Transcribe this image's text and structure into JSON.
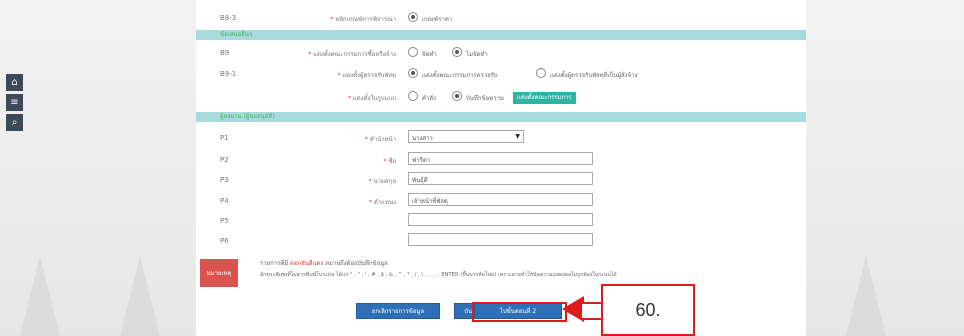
{
  "sidebar": {
    "icons": [
      "home-icon",
      "menu-icon",
      "search-icon"
    ],
    "glyphs": [
      "⌂",
      "≡",
      "⌕"
    ]
  },
  "form": {
    "row_b8_3": {
      "code": "B8-3",
      "label": "หลักเกณฑ์การพิจารณา",
      "option": "เกณฑ์ราคา"
    },
    "section_other": "ข้อเสนออื่นๆ",
    "row_b9": {
      "code": "B9",
      "label": "แต่งตั้งคณะกรรมการซื้อหรือจ้าง",
      "opt1": "จัดทำ",
      "opt2": "ไม่จัดทำ"
    },
    "row_b9_1": {
      "code": "B9-1",
      "label": "แต่งตั้งผู้ตรวจรับพัสดุ",
      "opt1": "แต่งตั้งคณะกรรมการตรวจรับ",
      "opt2": "แต่งตั้งผู้ตรวจรับพัสดุที่เป็นผู้สั่งจ้าง"
    },
    "row_committee": {
      "label": "แต่งตั้งในรูปแบบ",
      "opt1": "คำสั่ง",
      "opt2": "บันทึกข้อความ",
      "button": "แต่งตั้งคณะกรรมการ"
    },
    "section_approver": "ผู้ลงนาม (ผู้ขออนุมัติ)",
    "p1": {
      "code": "P1",
      "label": "คำนำหน้า",
      "value": "นางสาว"
    },
    "p2": {
      "code": "P2",
      "label": "ชื่อ",
      "value": "ฟารีดา"
    },
    "p3": {
      "code": "P3",
      "label": "นามสกุล",
      "value": "พันธุ์ดี"
    },
    "p4": {
      "code": "P4",
      "label": "ตำแหน่ง",
      "value": "เจ้าหน้าที่พัสดุ"
    },
    "p5": {
      "code": "P5",
      "value": ""
    },
    "p6": {
      "code": "P6",
      "value": ""
    }
  },
  "note": {
    "badge": "หมายเหตุ",
    "line1_prefix": "รายการที่มี",
    "line1_red": "ดอกจันสีแดง",
    "line1_suffix": "หมายถึงต้องบันทึกข้อมูล",
    "line2": "อักขระพิเศษที่ไม่ควรพิมพ์ในระบบ ได้แก่ \" , \" ; ' , # , $ , & , ^ , * , / , \\ , . . . ; ENTER (ขึ้นบรรทัดใหม่) เพราะอาจทำให้ข้อความแสดงผลไม่ถูกต้องในระบบได้"
  },
  "buttons": {
    "reset": "ยกเลิกรายการข้อมูล",
    "save": "บันทึก",
    "next": "ไปขั้นตอนที่ 2"
  },
  "annotation": {
    "step": "60."
  },
  "colors": {
    "section": "#a8dcdc",
    "primary": "#2f6fb6",
    "accent": "#2fb4a4",
    "callout": "#e01b1b"
  }
}
